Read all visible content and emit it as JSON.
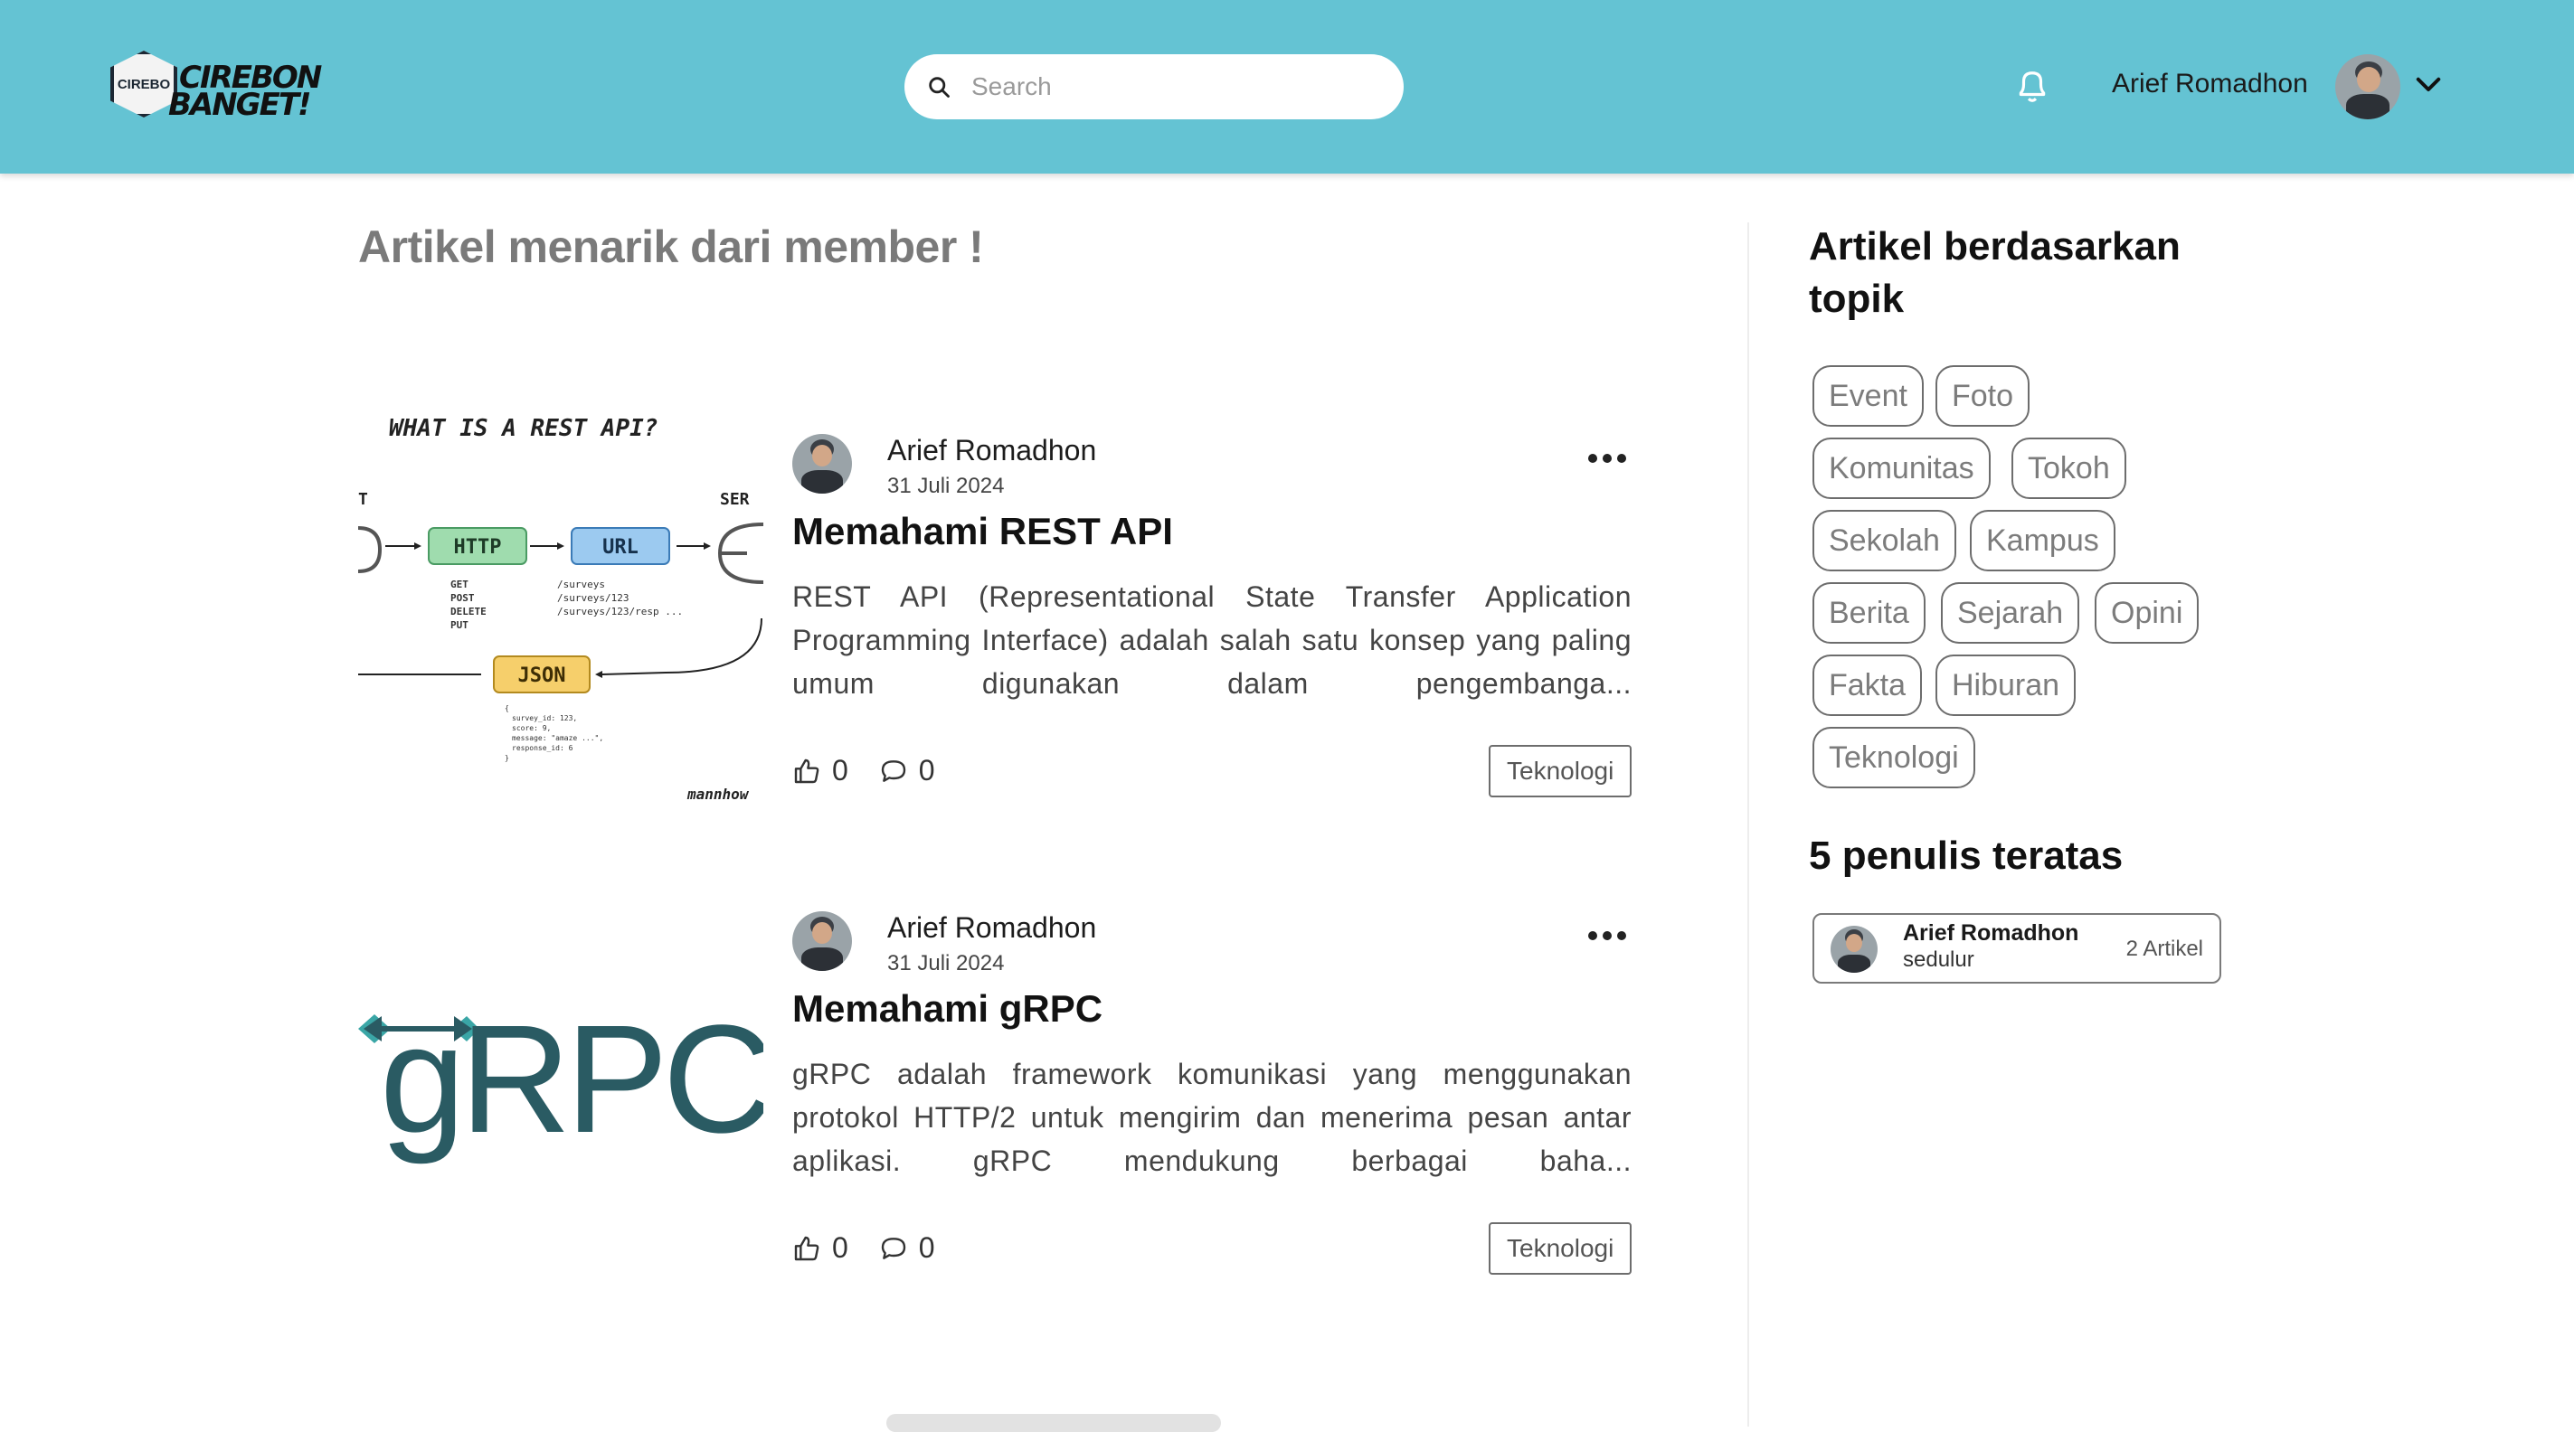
{
  "header": {
    "logo_badge": "CIREBO",
    "logo_line1": "CIREBON",
    "logo_line2": "BANGET!",
    "search_placeholder": "Search",
    "user_name": "Arief Romadhon",
    "icons": [
      "search-icon",
      "bell-icon",
      "chevron-down-icon"
    ],
    "accent_color": "#64c3d3"
  },
  "main": {
    "title": "Artikel menarik dari member !",
    "articles": [
      {
        "author": "Arief Romadhon",
        "date": "31 Juli 2024",
        "title": "Memahami REST API",
        "excerpt": "REST API (Representational State Transfer Application Programming Interface) adalah salah satu konsep yang paling umum digunakan dalam pengembanga...",
        "likes": "0",
        "comments": "0",
        "tag": "Teknologi",
        "thumb": {
          "heading": "WHAT IS A REST API?",
          "left_label": "T",
          "right_label": "SER",
          "http": "HTTP",
          "methods": "GET\nPOST\nDELETE\nPUT",
          "url": "URL",
          "paths": "/surveys\n/surveys/123\n/surveys/123/resp ...",
          "json": "JSON",
          "json_body": "{\n  survey_id: 123,\n  score: 9,\n  message: \"amaze ...\",\n  response_id: 6\n}",
          "credit": "mannhow"
        }
      },
      {
        "author": "Arief Romadhon",
        "date": "31 Juli 2024",
        "title": "Memahami gRPC",
        "excerpt": "gRPC adalah framework komunikasi yang menggunakan protokol HTTP/2 untuk mengirim dan menerima pesan antar aplikasi. gRPC mendukung berbagai baha...",
        "likes": "0",
        "comments": "0",
        "tag": "Teknologi",
        "thumb": {
          "logo_text": "gRPC",
          "logo_color": "#2a5b63",
          "arrow_color": "#3aa6a6"
        }
      }
    ]
  },
  "sidebar": {
    "topics_title": "Artikel berdasarkan topik",
    "topics": [
      "Event",
      "Foto",
      "Komunitas",
      "Tokoh",
      "Sekolah",
      "Kampus",
      "Berita",
      "Sejarah",
      "Opini",
      "Fakta",
      "Hiburan",
      "Teknologi"
    ],
    "writers_title": "5 penulis teratas",
    "writers": [
      {
        "name": "Arief Romadhon",
        "role": "sedulur",
        "count": "2 Artikel"
      }
    ]
  }
}
